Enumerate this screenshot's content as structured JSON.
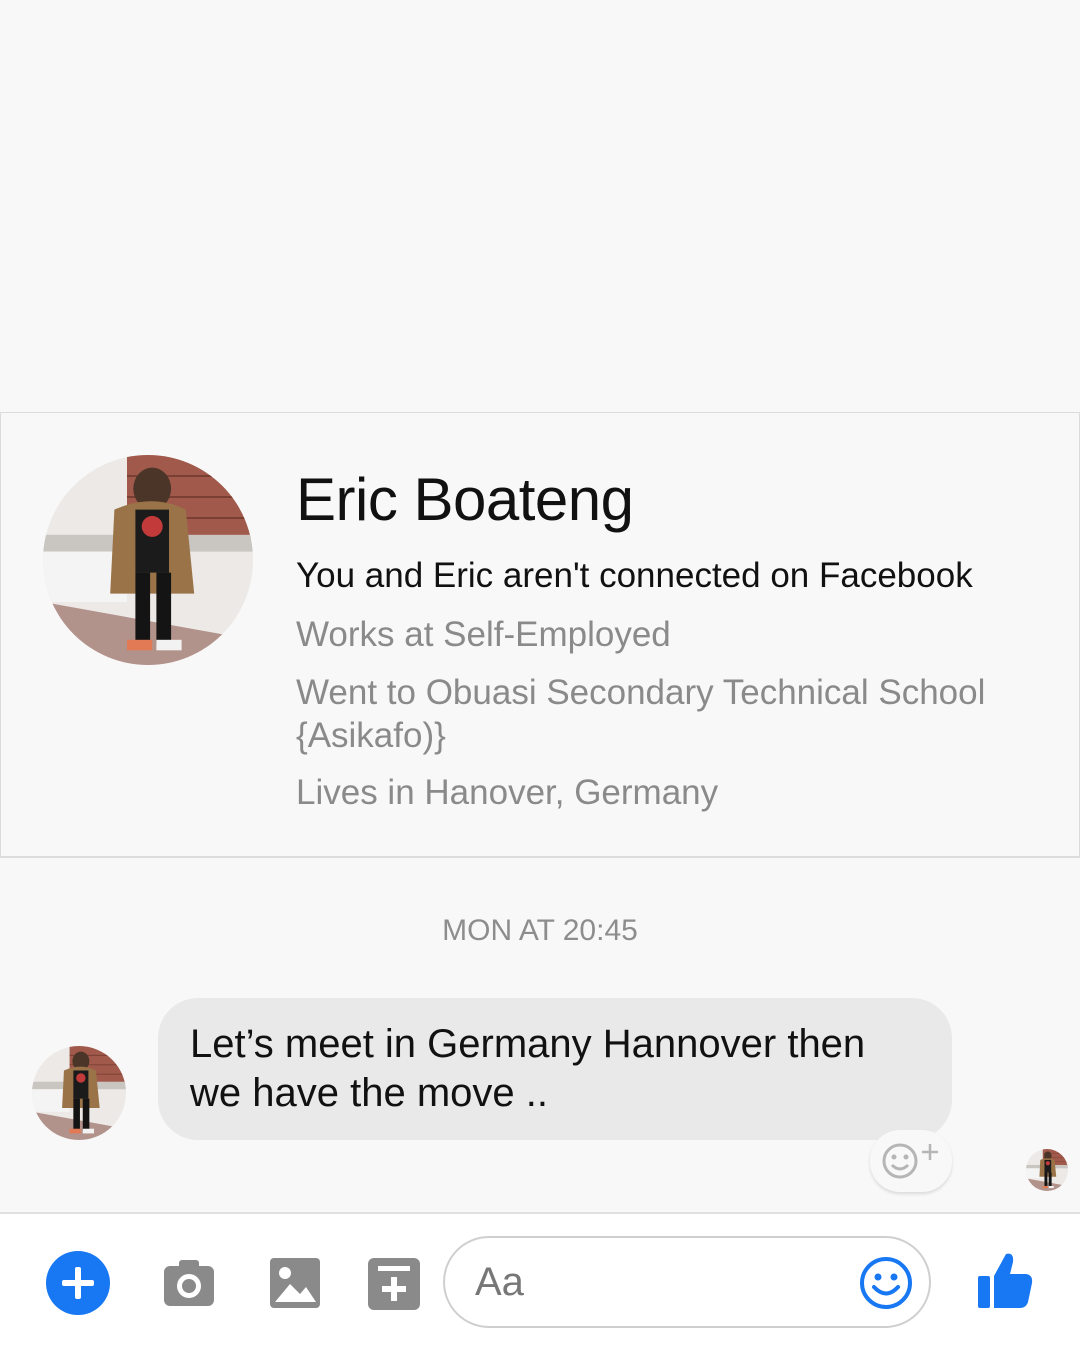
{
  "profile": {
    "name": "Eric Boateng",
    "connection_status": "You and Eric aren't connected on Facebook",
    "work": "Works at Self-Employed",
    "education": "Went to Obuasi Secondary Technical School {Asikafo)}",
    "location": "Lives in Hanover, Germany"
  },
  "thread": {
    "timestamp": "MON AT 20:45",
    "messages": [
      {
        "sender": "Eric Boateng",
        "text": "Let’s meet in Germany Hannover then we have the move .."
      }
    ]
  },
  "composer": {
    "placeholder": "Aa",
    "icons": [
      "plus-icon",
      "camera-icon",
      "gallery-icon",
      "more-actions-icon",
      "emoji-icon",
      "like-icon"
    ]
  },
  "colors": {
    "accent": "#1877f2",
    "background": "#f8f8f8",
    "bubble": "#e9e9e9",
    "secondary_text": "#8a8a8a",
    "icon_gray": "#8a8a8a"
  }
}
